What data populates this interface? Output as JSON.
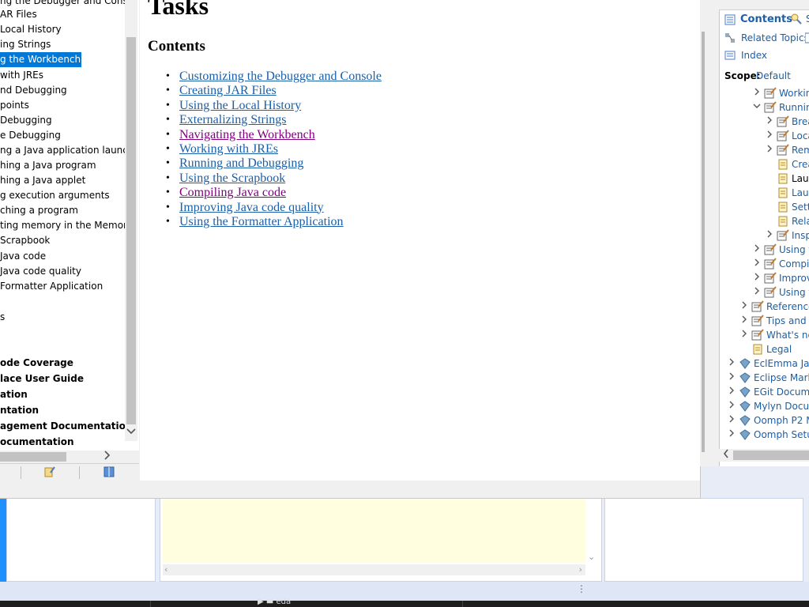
{
  "toc": {
    "items": [
      {
        "label": "ng the Debugger and Console"
      },
      {
        "label": "AR Files"
      },
      {
        "label": "Local History"
      },
      {
        "label": "ing Strings"
      },
      {
        "label": "g the Workbench"
      },
      {
        "label": "with JREs"
      },
      {
        "label": "nd Debugging"
      },
      {
        "label": "points"
      },
      {
        "label": "Debugging"
      },
      {
        "label": "e Debugging"
      },
      {
        "label": "ng a Java application launch co"
      },
      {
        "label": "hing a Java program"
      },
      {
        "label": "hing a Java applet"
      },
      {
        "label": "g execution arguments"
      },
      {
        "label": "ching a program"
      },
      {
        "label": "ting memory in the Memory v"
      },
      {
        "label": "Scrapbook"
      },
      {
        "label": "Java code"
      },
      {
        "label": "Java code quality"
      },
      {
        "label": "Formatter Application"
      },
      {
        "label": ""
      },
      {
        "label": "s"
      },
      {
        "label": ""
      },
      {
        "label": ""
      },
      {
        "label": "ode Coverage"
      },
      {
        "label": "lace User Guide"
      },
      {
        "label": "ation"
      },
      {
        "label": "ntation"
      },
      {
        "label": "agement Documentation"
      },
      {
        "label": "ocumentation"
      }
    ]
  },
  "content": {
    "title": "Tasks",
    "heading": "Contents",
    "links": [
      {
        "label": "Customizing the Debugger and Console"
      },
      {
        "label": "Creating JAR Files"
      },
      {
        "label": "Using the Local History"
      },
      {
        "label": "Externalizing Strings"
      },
      {
        "label": "Navigating the Workbench"
      },
      {
        "label": "Working with JREs"
      },
      {
        "label": "Running and Debugging"
      },
      {
        "label": "Using the Scrapbook"
      },
      {
        "label": "Compiling Java code"
      },
      {
        "label": "Improving Java code quality"
      },
      {
        "label": "Using the Formatter Application"
      }
    ]
  },
  "help_view": {
    "tabs": {
      "contents": "Contents",
      "search": "S",
      "related": "Related Topics",
      "index": "Index"
    },
    "scope_label": "Scope:",
    "scope_value": "Default",
    "tree": [
      {
        "label": "Working"
      },
      {
        "label": "Running"
      },
      {
        "label": "Breal"
      },
      {
        "label": "Loca"
      },
      {
        "label": "Rem"
      },
      {
        "label": "Creat"
      },
      {
        "label": "Laun"
      },
      {
        "label": "Laun"
      },
      {
        "label": "Settir"
      },
      {
        "label": "Relau"
      },
      {
        "label": "Inspe"
      },
      {
        "label": "Using th"
      },
      {
        "label": "Compili"
      },
      {
        "label": "Improvi"
      },
      {
        "label": "Using th"
      },
      {
        "label": "Reference"
      },
      {
        "label": "Tips and tri"
      },
      {
        "label": "What's new"
      },
      {
        "label": "Legal"
      },
      {
        "label": "EclEmma Java"
      },
      {
        "label": "Eclipse Marke"
      },
      {
        "label": "EGit Documen"
      },
      {
        "label": "Mylyn Docum"
      },
      {
        "label": "Oomph P2 Ma"
      },
      {
        "label": "Oomph Setup"
      }
    ]
  },
  "taskbar": {
    "item": "eda"
  }
}
